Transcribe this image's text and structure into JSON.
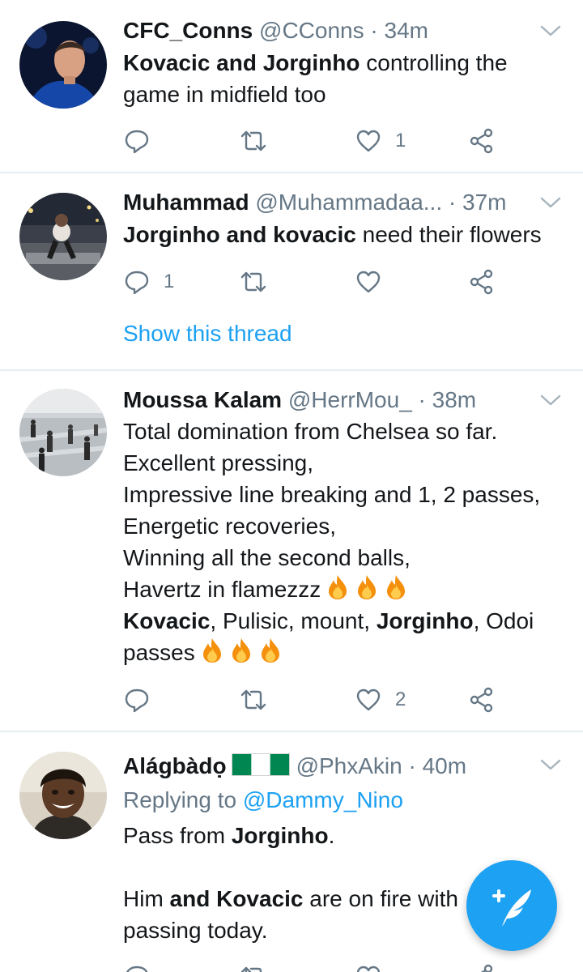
{
  "colors": {
    "accent": "#1da1f2",
    "muted": "#657786",
    "divider": "#e6ecf0"
  },
  "tweets": [
    {
      "name": "CFC_Conns",
      "handle": "@CConns",
      "dot": "·",
      "time": "34m",
      "lines": [
        [
          {
            "t": "Kovacic and Jorginho",
            "b": true
          },
          {
            "t": " controlling the"
          }
        ],
        [
          {
            "t": "game in midfield too"
          }
        ]
      ],
      "reply_count": "",
      "retweet_count": "",
      "like_count": "1"
    },
    {
      "name": "Muhammad",
      "handle": "@Muhammadaa...",
      "dot": "·",
      "time": "37m",
      "lines": [
        [
          {
            "t": "Jorginho and kovacic",
            "b": true
          },
          {
            "t": " need their flowers"
          }
        ]
      ],
      "reply_count": "1",
      "retweet_count": "",
      "like_count": "",
      "show_thread": "Show this thread"
    },
    {
      "name": "Moussa Kalam",
      "handle": "@HerrMou_",
      "dot": "·",
      "time": "38m",
      "lines": [
        [
          {
            "t": "Total domination from Chelsea so far."
          }
        ],
        [
          {
            "t": "Excellent pressing,"
          }
        ],
        [
          {
            "t": "Impressive line breaking and 1, 2 passes,"
          }
        ],
        [
          {
            "t": "Energetic recoveries,"
          }
        ],
        [
          {
            "t": "Winning all the second balls,"
          }
        ],
        [
          {
            "t": "Havertz in flamezzz"
          },
          {
            "emoji": "fire"
          },
          {
            "emoji": "fire"
          },
          {
            "emoji": "fire"
          }
        ],
        [
          {
            "t": "Kovacic",
            "b": true
          },
          {
            "t": ", Pulisic, mount, "
          },
          {
            "t": "Jorginho",
            "b": true
          },
          {
            "t": ", Odoi"
          }
        ],
        [
          {
            "t": "passes"
          },
          {
            "emoji": "fire"
          },
          {
            "emoji": "fire"
          },
          {
            "emoji": "fire"
          }
        ]
      ],
      "reply_count": "",
      "retweet_count": "",
      "like_count": "2"
    },
    {
      "name": "Alágbàdọ",
      "flag": "nigeria-flag",
      "handle": "@PhxAkin",
      "dot": "·",
      "time": "40m",
      "replying_prefix": "Replying to",
      "replying_handle": "@Dammy_Nino",
      "lines": [
        [
          {
            "t": "Pass from "
          },
          {
            "t": "Jorginho",
            "b": true
          },
          {
            "t": "."
          }
        ],
        [],
        [
          {
            "t": "Him "
          },
          {
            "t": "and Kovacic",
            "b": true
          },
          {
            "t": " are on fire with"
          }
        ],
        [
          {
            "t": "passing today."
          }
        ]
      ]
    }
  ],
  "icons": [
    "reply-icon",
    "retweet-icon",
    "like-icon",
    "share-icon",
    "chevron-down-icon",
    "compose-tweet-icon",
    "fire-emoji-icon"
  ],
  "fab": {
    "label": "compose-tweet"
  }
}
